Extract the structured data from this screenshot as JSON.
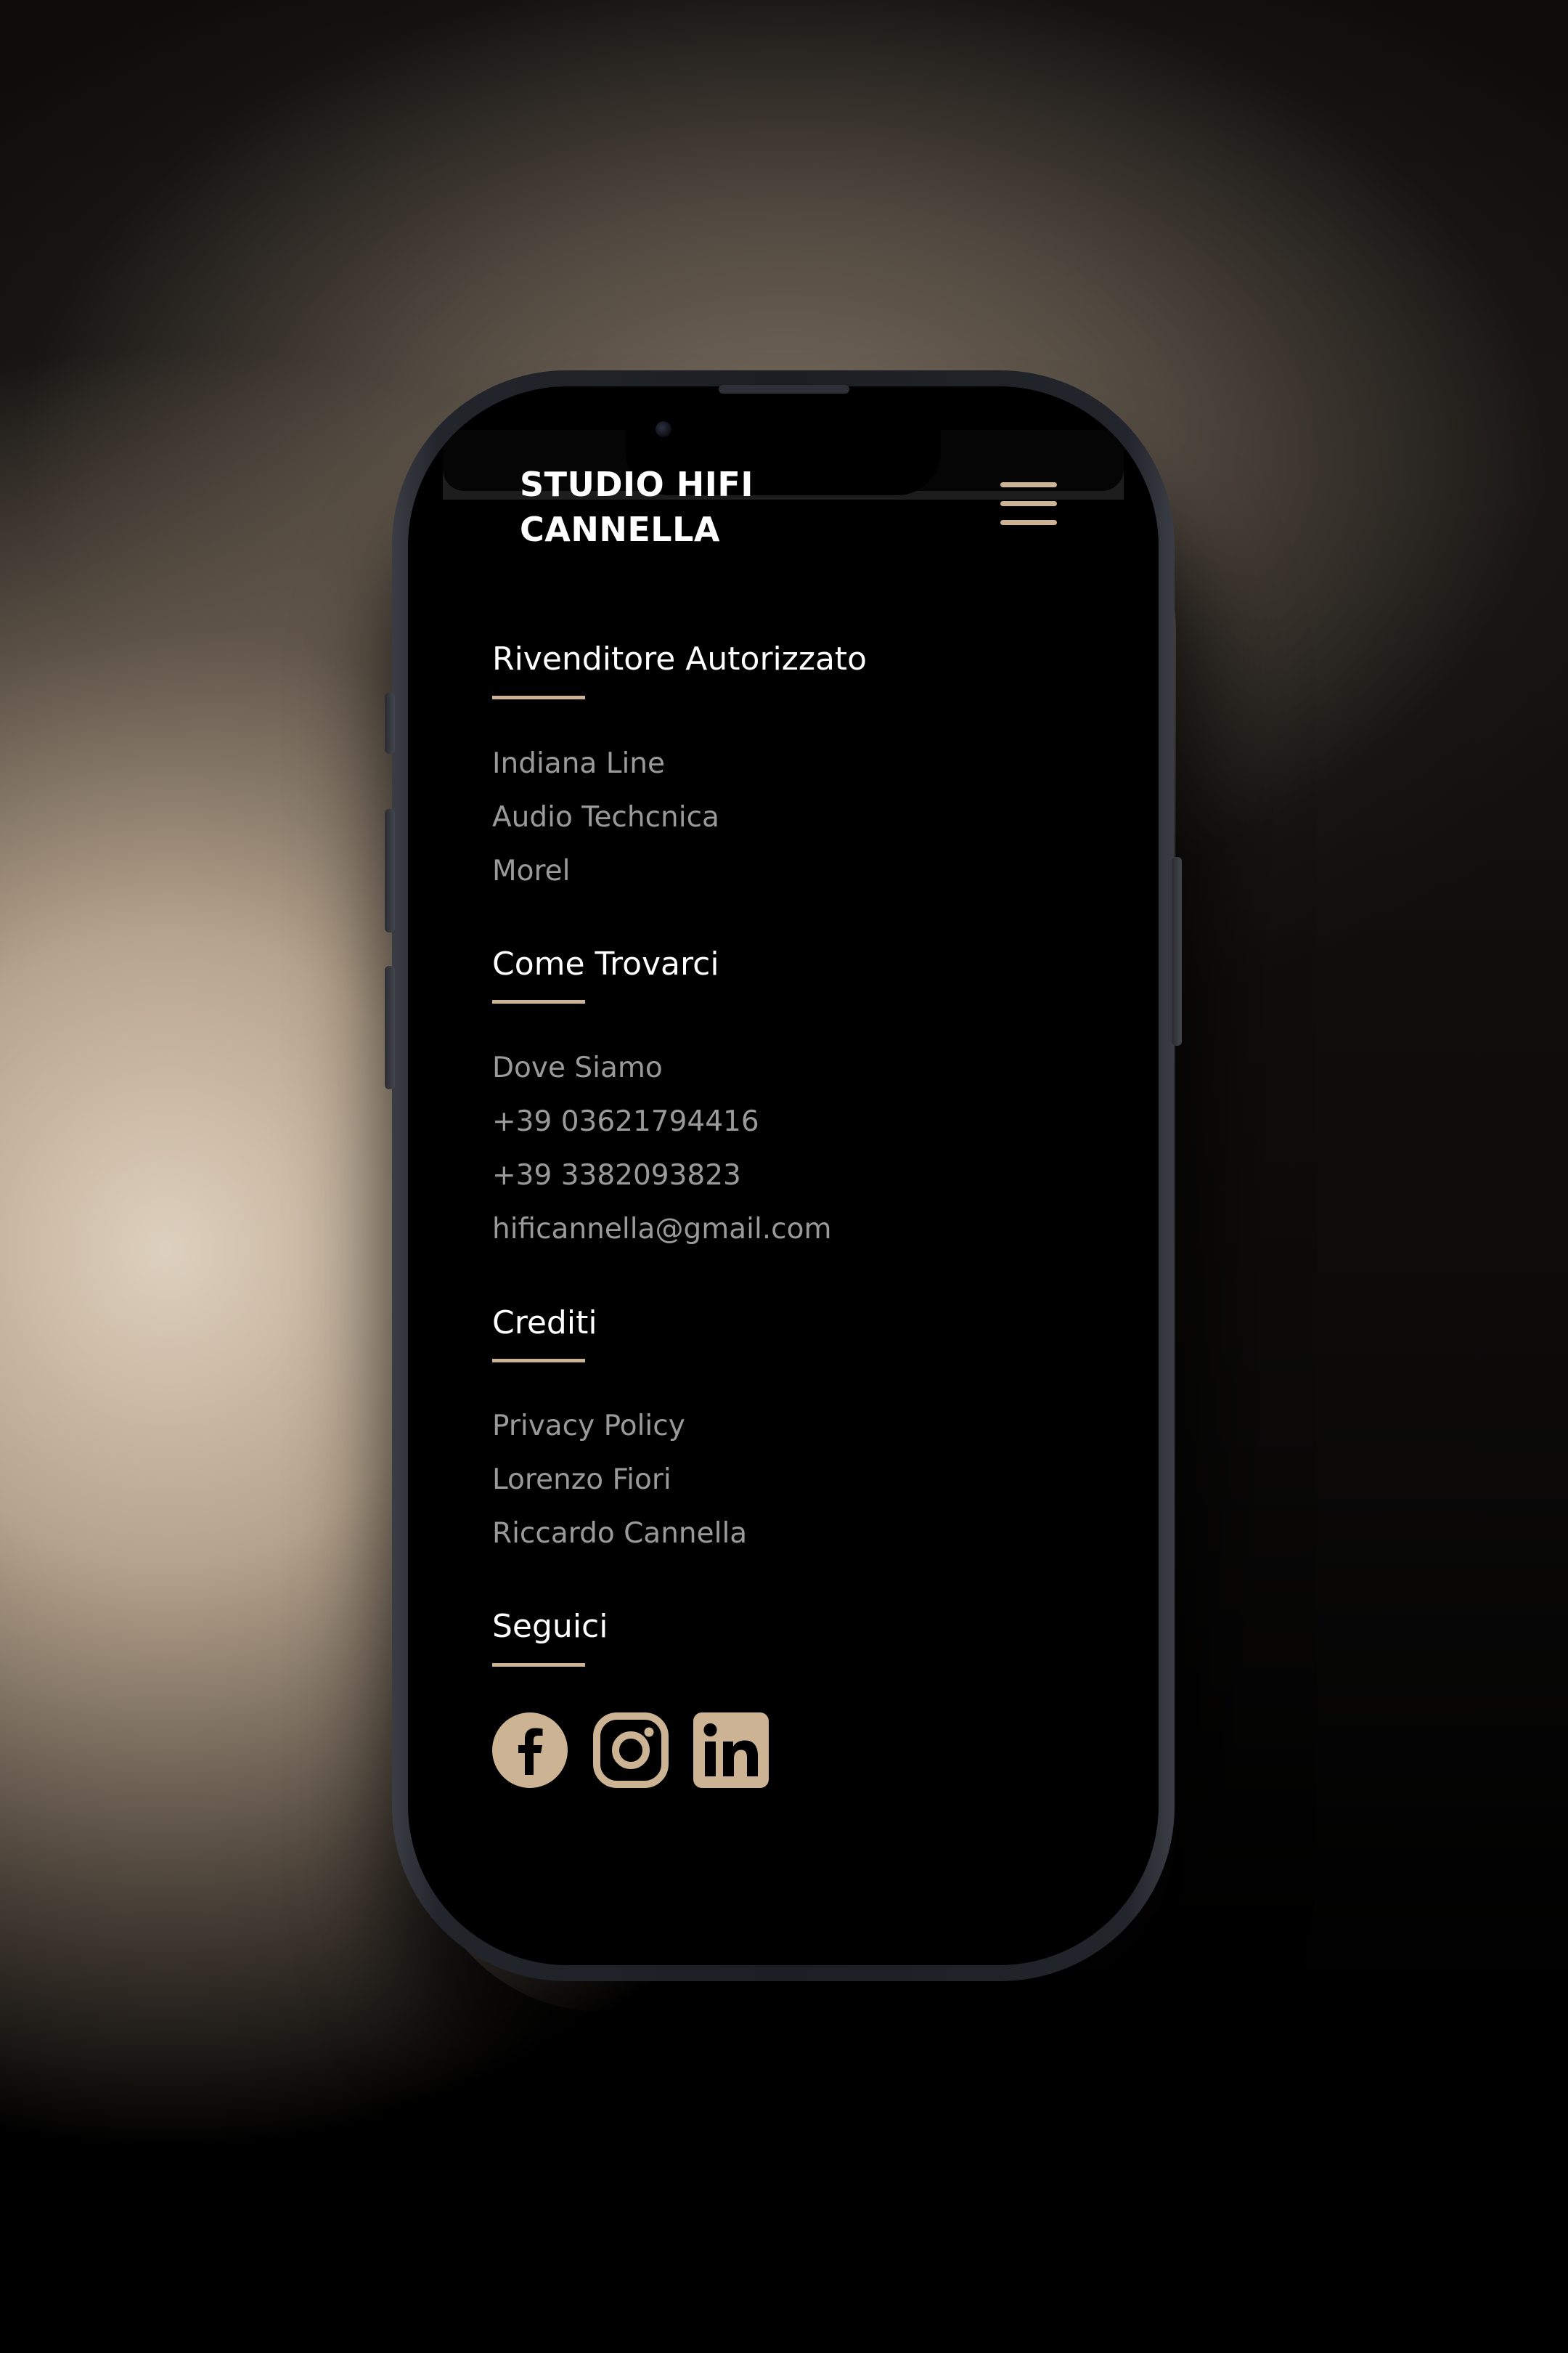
{
  "site": {
    "brand_line1": "STUDIO HIFI",
    "brand_line2": "CANNELLA"
  },
  "colors": {
    "accent": "#cbb393",
    "text_primary": "#ffffff",
    "text_secondary": "#9a9a9a",
    "background": "#000000"
  },
  "menu": {
    "icon": "hamburger-menu-icon"
  },
  "footer": {
    "sections": [
      {
        "title": "Rivenditore Autorizzato",
        "items": [
          "Indiana Line",
          "Audio Techcnica",
          "Morel"
        ]
      },
      {
        "title": "Come Trovarci",
        "items": [
          "Dove Siamo",
          "+39 03621794416",
          "+39 3382093823",
          "hificannella@gmail.com"
        ]
      },
      {
        "title": "Crediti",
        "items": [
          "Privacy Policy",
          "Lorenzo Fiori",
          "Riccardo Cannella"
        ]
      },
      {
        "title": "Seguici",
        "social": [
          "facebook-icon",
          "instagram-icon",
          "linkedin-icon"
        ]
      }
    ]
  }
}
